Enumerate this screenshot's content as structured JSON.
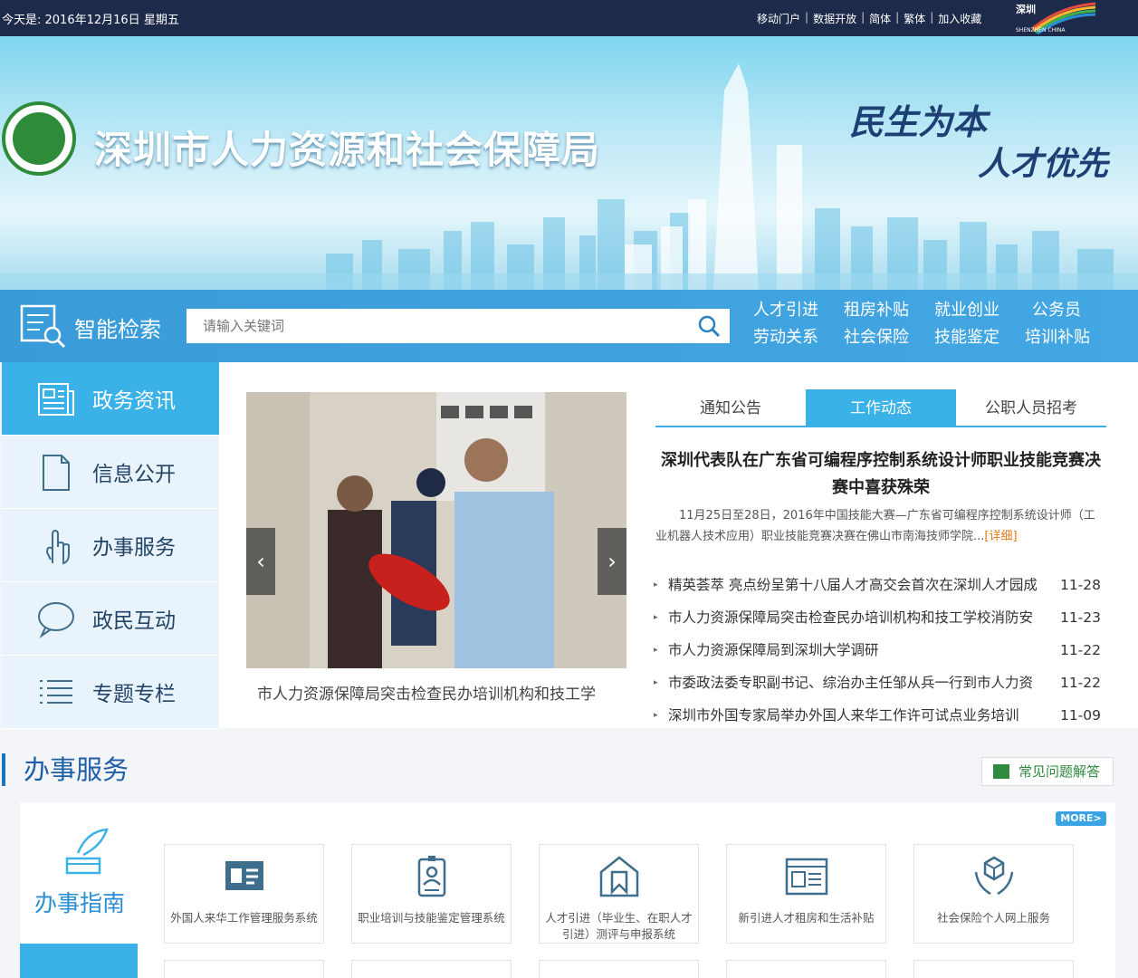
{
  "topbar": {
    "date": "今天是: 2016年12月16日 星期五",
    "links": [
      "移动门户",
      "数据开放",
      "简体",
      "繁体",
      "加入收藏"
    ],
    "sz_logo_text": "SHENZHEN CHINA"
  },
  "banner": {
    "title": "深圳市人力资源和社会保障局",
    "slogan_1": "民生为本",
    "slogan_2": "人才优先"
  },
  "search": {
    "label": "智能检索",
    "placeholder": "请输入关键词",
    "quick_links": [
      "人才引进",
      "租房补贴",
      "就业创业",
      "公务员",
      "劳动关系",
      "社会保险",
      "技能鉴定",
      "培训补贴"
    ]
  },
  "left_nav": [
    {
      "label": "政务资讯",
      "icon": "news-icon",
      "active": true
    },
    {
      "label": "信息公开",
      "icon": "document-icon",
      "active": false
    },
    {
      "label": "办事服务",
      "icon": "hand-pointer-icon",
      "active": false
    },
    {
      "label": "政民互动",
      "icon": "chat-bubble-icon",
      "active": false
    },
    {
      "label": "专题专栏",
      "icon": "list-icon",
      "active": false
    }
  ],
  "slider": {
    "caption": "市人力资源保障局突击检查民办培训机构和技工学",
    "prev": "‹",
    "next": "›"
  },
  "tabs": [
    "通知公告",
    "工作动态",
    "公职人员招考"
  ],
  "active_tab": 1,
  "headline": "深圳代表队在广东省可编程序控制系统设计师职业技能竞赛决赛中喜获殊荣",
  "summary": {
    "text": "11月25日至28日，2016年中国技能大赛—广东省可编程序控制系统设计师（工业机器人技术应用）职业技能竞赛决赛在佛山市南海技师学院...",
    "more": "[详细]"
  },
  "news": [
    {
      "title": "精英荟萃 亮点纷呈第十八届人才高交会首次在深圳人才园成",
      "date": "11-28"
    },
    {
      "title": "市人力资源保障局突击检查民办培训机构和技工学校消防安",
      "date": "11-23"
    },
    {
      "title": "市人力资源保障局到深圳大学调研",
      "date": "11-22"
    },
    {
      "title": "市委政法委专职副书记、综治办主任邹从兵一行到市人力资",
      "date": "11-22"
    },
    {
      "title": "深圳市外国专家局举办外国人来华工作许可试点业务培训",
      "date": "11-09"
    }
  ],
  "services": {
    "section_title": "办事服务",
    "faq": "常见问题解答",
    "guide_label": "办事指南",
    "more": "MORE>",
    "cards": [
      {
        "label": "外国人来华工作管理服务系统",
        "icon": "id-card-icon"
      },
      {
        "label": "职业培训与技能鉴定管理系统",
        "icon": "badge-icon"
      },
      {
        "label": "人才引进（毕业生、在职人才引进）测评与申报系统",
        "icon": "house-bookmark-icon"
      },
      {
        "label": "新引进人才租房和生活补贴",
        "icon": "newspaper-icon"
      },
      {
        "label": "社会保险个人网上服务",
        "icon": "hands-box-icon"
      }
    ]
  },
  "colors": {
    "topbar_bg": "#1e2a4a",
    "accent": "#3ab2e8",
    "search_bar": "#3a9bd9",
    "title_blue": "#1e5fa8",
    "green": "#2d8a3e",
    "detail_orange": "#e67a18"
  }
}
